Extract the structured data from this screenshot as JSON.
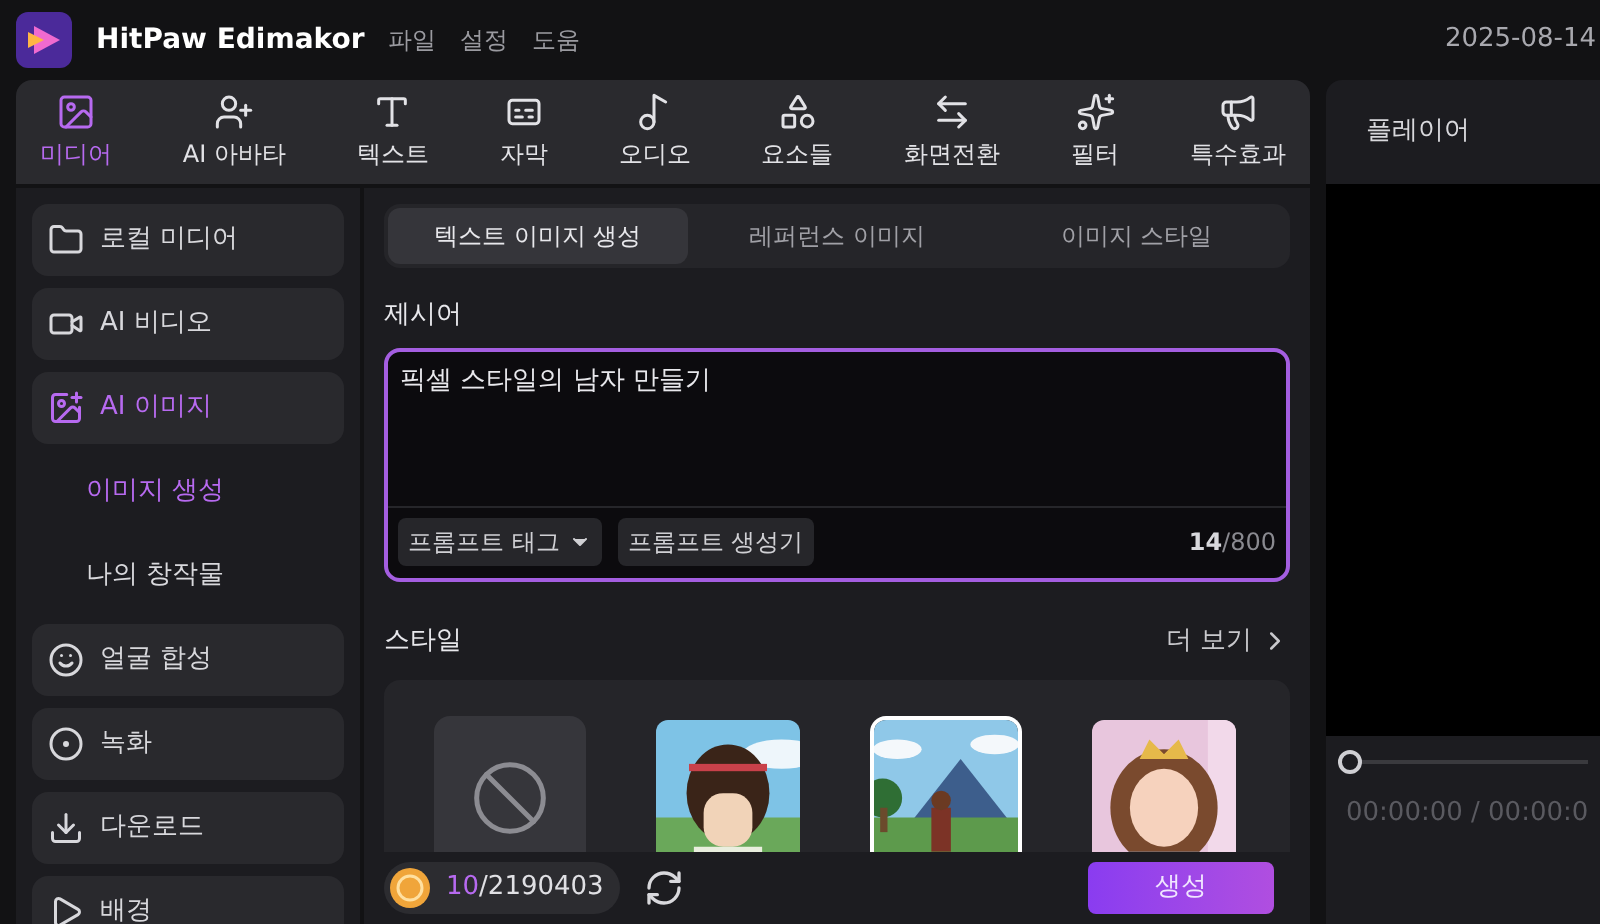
{
  "app": {
    "title": "HitPaw Edimakor",
    "menu": [
      "파일",
      "설정",
      "도움"
    ],
    "date": "2025-08-14"
  },
  "toolbar": [
    {
      "label": "미디어",
      "selected": true
    },
    {
      "label": "AI 아바타",
      "selected": false
    },
    {
      "label": "텍스트",
      "selected": false
    },
    {
      "label": "자막",
      "selected": false
    },
    {
      "label": "오디오",
      "selected": false
    },
    {
      "label": "요소들",
      "selected": false
    },
    {
      "label": "화면전환",
      "selected": false
    },
    {
      "label": "필터",
      "selected": false
    },
    {
      "label": "특수효과",
      "selected": false
    }
  ],
  "sidebar": [
    {
      "label": "로컬 미디어",
      "selected": false
    },
    {
      "label": "AI 비디오",
      "selected": false
    },
    {
      "label": "AI 이미지",
      "selected": true,
      "children": [
        {
          "label": "이미지 생성",
          "selected": true
        },
        {
          "label": "나의 창작물",
          "selected": false
        }
      ]
    },
    {
      "label": "얼굴 합성",
      "selected": false
    },
    {
      "label": "녹화",
      "selected": false
    },
    {
      "label": "다운로드",
      "selected": false
    },
    {
      "label": "배경",
      "selected": false
    }
  ],
  "mode_tabs": [
    {
      "label": "텍스트 이미지 생성",
      "selected": true
    },
    {
      "label": "레퍼런스 이미지",
      "selected": false
    },
    {
      "label": "이미지 스타일",
      "selected": false
    }
  ],
  "prompt": {
    "label": "제시어",
    "value": "픽셀 스타일의 남자 만들기",
    "tag_button": "프롬프트 태그",
    "generator_button": "프롬프트 생성기",
    "count": "14",
    "max": "/800"
  },
  "style": {
    "title": "스타일",
    "more": "더 보기",
    "options": [
      {
        "kind": "none",
        "selected": false
      },
      {
        "kind": "picture",
        "selected": false
      },
      {
        "kind": "picture",
        "selected": true
      },
      {
        "kind": "picture",
        "selected": false
      }
    ]
  },
  "credits": {
    "used": "10",
    "total": "/2190403"
  },
  "generate_button": "생성",
  "player": {
    "title": "플레이어",
    "level": 0,
    "time": "00:00:00 / 00:00:0"
  }
}
